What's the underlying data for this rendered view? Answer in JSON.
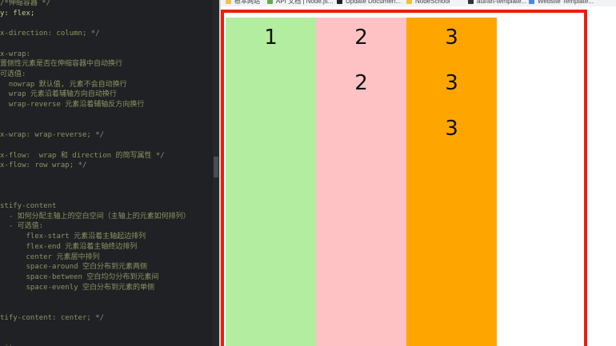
{
  "editor": {
    "lines": [
      {
        "text": "/*伸缩容器 */",
        "cls": "comment"
      },
      {
        "text": "y: flex;",
        "cls": "prop"
      },
      {
        "text": "",
        "cls": ""
      },
      {
        "text": "x-direction: column; */",
        "cls": "comment"
      },
      {
        "text": "",
        "cls": ""
      },
      {
        "text": "x-wrap:",
        "cls": "comment"
      },
      {
        "text": "置侧性元素是否在伸缩容器中自动换行",
        "cls": "comment"
      },
      {
        "text": "可选值:",
        "cls": "comment"
      },
      {
        "text": "  nowrap 默认值, 元素不会自动换行",
        "cls": "comment"
      },
      {
        "text": "  wrap 元素沿着辅轴方向自动换行",
        "cls": "comment"
      },
      {
        "text": "  wrap-reverse 元素沿着辅轴反方向换行",
        "cls": "comment"
      },
      {
        "text": "",
        "cls": ""
      },
      {
        "text": "",
        "cls": ""
      },
      {
        "text": "x-wrap: wrap-reverse; */",
        "cls": "comment"
      },
      {
        "text": "",
        "cls": ""
      },
      {
        "text": "x-flow:  wrap 和 direction 的简写属性 */",
        "cls": "comment"
      },
      {
        "text": "x-flow: row wrap; */",
        "cls": "comment"
      },
      {
        "text": "",
        "cls": ""
      },
      {
        "text": "",
        "cls": ""
      },
      {
        "text": "",
        "cls": ""
      },
      {
        "text": "stify-content",
        "cls": "comment"
      },
      {
        "text": "  - 如何分配主轴上的空白空间（主轴上的元素如何排列）",
        "cls": "comment"
      },
      {
        "text": "  - 可选值:",
        "cls": "comment"
      },
      {
        "text": "      flex-start 元素沿着主轴起边排列",
        "cls": "comment"
      },
      {
        "text": "      flex-end 元素沿着主轴终边排列",
        "cls": "comment"
      },
      {
        "text": "      center 元素居中排列",
        "cls": "comment"
      },
      {
        "text": "      space-around 空白分布到元素两侧",
        "cls": "comment"
      },
      {
        "text": "      space-between 空白均匀分布到元素间",
        "cls": "comment"
      },
      {
        "text": "      space-evenly 空白分布到元素的单侧",
        "cls": "comment"
      },
      {
        "text": "",
        "cls": ""
      },
      {
        "text": "",
        "cls": ""
      },
      {
        "text": "tify-content: center; */",
        "cls": "comment"
      },
      {
        "text": "",
        "cls": ""
      },
      {
        "text": "",
        "cls": ""
      },
      {
        "text": "-items:",
        "cls": "comment"
      }
    ]
  },
  "bookmarks": [
    {
      "label": "根本网站",
      "color": "#f2c14e"
    },
    {
      "label": "API 文档 | Node.js...",
      "color": "#6aa84f"
    },
    {
      "label": "Update Documen...",
      "color": "#222222"
    },
    {
      "label": "NodeSchool",
      "color": "#f1c232"
    },
    {
      "label": "aui/art-template...",
      "color": "#333333"
    },
    {
      "label": "Website Template...",
      "color": "#4a86e8"
    }
  ],
  "colors": {
    "item1": "#b3ed9f",
    "item2": "#ffc2c4",
    "item3": "#ffa500",
    "border": "#ee1c0e"
  },
  "flex_items": [
    {
      "bg": "#b3ed9f",
      "numbers": [
        "1"
      ]
    },
    {
      "bg": "#ffc2c4",
      "numbers": [
        "2",
        "2"
      ]
    },
    {
      "bg": "#ffa500",
      "numbers": [
        "3",
        "3",
        "3"
      ]
    }
  ]
}
